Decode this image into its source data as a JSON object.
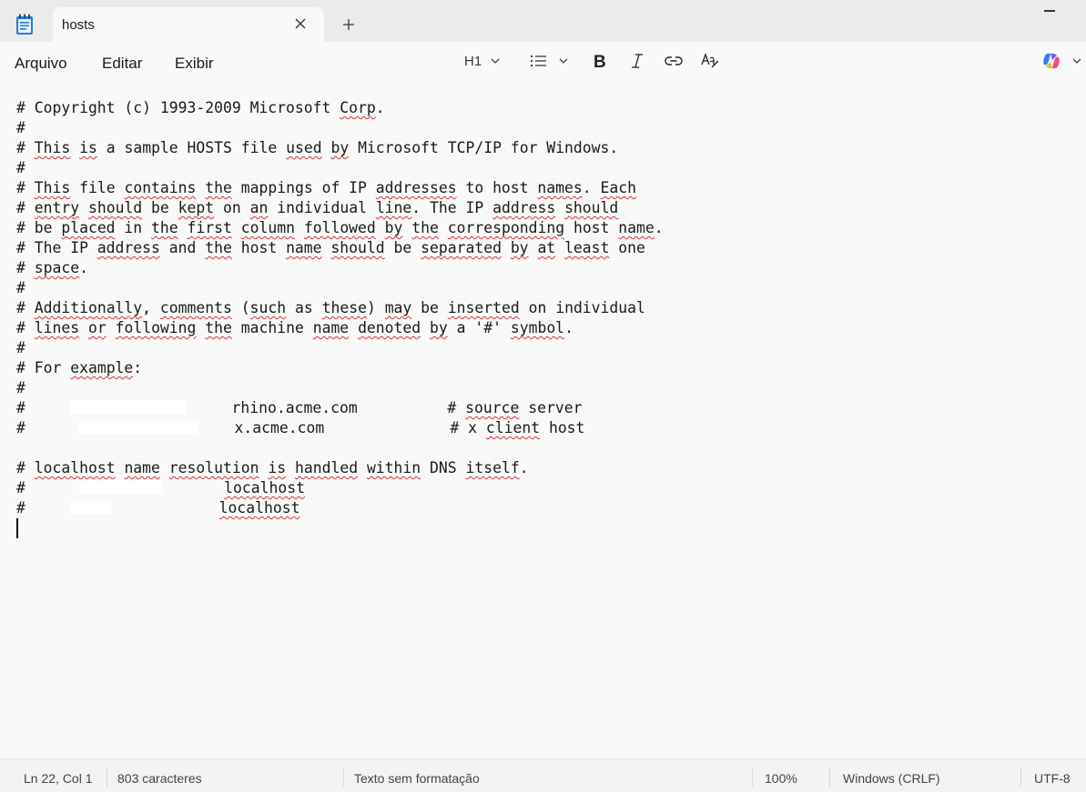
{
  "tab": {
    "title": "hosts"
  },
  "menu": {
    "file": "Arquivo",
    "edit": "Editar",
    "view": "Exibir"
  },
  "toolbar": {
    "heading": "H1",
    "icons": [
      "heading-icon",
      "list-icon",
      "bold-icon",
      "italic-icon",
      "link-icon",
      "clear-formatting-icon",
      "copilot-icon"
    ]
  },
  "lines": [
    [
      {
        "t": "# Copyright (c) 1993-2009 Microsoft "
      },
      {
        "t": "Corp",
        "e": 1
      },
      {
        "t": "."
      }
    ],
    [
      {
        "t": "#"
      }
    ],
    [
      {
        "t": "# "
      },
      {
        "t": "This",
        "e": 1
      },
      {
        "t": " "
      },
      {
        "t": "is",
        "e": 1
      },
      {
        "t": " a sample HOSTS file "
      },
      {
        "t": "used",
        "e": 1
      },
      {
        "t": " "
      },
      {
        "t": "by",
        "e": 1
      },
      {
        "t": " Microsoft TCP/IP for Windows."
      }
    ],
    [
      {
        "t": "#"
      }
    ],
    [
      {
        "t": "# "
      },
      {
        "t": "This",
        "e": 1
      },
      {
        "t": " file "
      },
      {
        "t": "contains",
        "e": 1
      },
      {
        "t": " "
      },
      {
        "t": "the",
        "e": 1
      },
      {
        "t": " mappings of IP "
      },
      {
        "t": "addresses",
        "e": 1
      },
      {
        "t": " to host "
      },
      {
        "t": "names",
        "e": 1
      },
      {
        "t": ". "
      },
      {
        "t": "Each",
        "e": 1
      }
    ],
    [
      {
        "t": "# "
      },
      {
        "t": "entry",
        "e": 1
      },
      {
        "t": " "
      },
      {
        "t": "should",
        "e": 1
      },
      {
        "t": " be "
      },
      {
        "t": "kept",
        "e": 1
      },
      {
        "t": " on "
      },
      {
        "t": "an",
        "e": 1
      },
      {
        "t": " individual "
      },
      {
        "t": "line",
        "e": 1
      },
      {
        "t": ". The IP "
      },
      {
        "t": "address",
        "e": 1
      },
      {
        "t": " "
      },
      {
        "t": "should",
        "e": 1
      }
    ],
    [
      {
        "t": "# be "
      },
      {
        "t": "placed",
        "e": 1
      },
      {
        "t": " in "
      },
      {
        "t": "the",
        "e": 1
      },
      {
        "t": " "
      },
      {
        "t": "first",
        "e": 1
      },
      {
        "t": " "
      },
      {
        "t": "column",
        "e": 1
      },
      {
        "t": " "
      },
      {
        "t": "followed",
        "e": 1
      },
      {
        "t": " "
      },
      {
        "t": "by",
        "e": 1
      },
      {
        "t": " "
      },
      {
        "t": "the",
        "e": 1
      },
      {
        "t": " "
      },
      {
        "t": "corresponding",
        "e": 1
      },
      {
        "t": " host "
      },
      {
        "t": "name",
        "e": 1
      },
      {
        "t": "."
      }
    ],
    [
      {
        "t": "# The IP "
      },
      {
        "t": "address",
        "e": 1
      },
      {
        "t": " and "
      },
      {
        "t": "the",
        "e": 1
      },
      {
        "t": " host "
      },
      {
        "t": "name",
        "e": 1
      },
      {
        "t": " "
      },
      {
        "t": "should",
        "e": 1
      },
      {
        "t": " be "
      },
      {
        "t": "separated",
        "e": 1
      },
      {
        "t": " "
      },
      {
        "t": "by",
        "e": 1
      },
      {
        "t": " "
      },
      {
        "t": "at",
        "e": 1
      },
      {
        "t": " "
      },
      {
        "t": "least",
        "e": 1
      },
      {
        "t": " one"
      }
    ],
    [
      {
        "t": "# "
      },
      {
        "t": "space",
        "e": 1
      },
      {
        "t": "."
      }
    ],
    [
      {
        "t": "#"
      }
    ],
    [
      {
        "t": "# "
      },
      {
        "t": "Additionally",
        "e": 1
      },
      {
        "t": ", "
      },
      {
        "t": "comments",
        "e": 1
      },
      {
        "t": " ("
      },
      {
        "t": "such",
        "e": 1
      },
      {
        "t": " as "
      },
      {
        "t": "these",
        "e": 1
      },
      {
        "t": ") "
      },
      {
        "t": "may",
        "e": 1
      },
      {
        "t": " be "
      },
      {
        "t": "inserted",
        "e": 1
      },
      {
        "t": " on individual"
      }
    ],
    [
      {
        "t": "# "
      },
      {
        "t": "lines",
        "e": 1
      },
      {
        "t": " "
      },
      {
        "t": "or",
        "e": 1
      },
      {
        "t": " "
      },
      {
        "t": "following",
        "e": 1
      },
      {
        "t": " "
      },
      {
        "t": "the",
        "e": 1
      },
      {
        "t": " machine "
      },
      {
        "t": "name",
        "e": 1
      },
      {
        "t": " "
      },
      {
        "t": "denoted",
        "e": 1
      },
      {
        "t": " "
      },
      {
        "t": "by",
        "e": 1
      },
      {
        "t": " a '#' "
      },
      {
        "t": "symbol",
        "e": 1
      },
      {
        "t": "."
      }
    ],
    [
      {
        "t": "#"
      }
    ],
    [
      {
        "t": "# For "
      },
      {
        "t": "example",
        "e": 1
      },
      {
        "t": ":"
      }
    ],
    [
      {
        "t": "#"
      }
    ],
    [
      {
        "t": "#     "
      },
      {
        "r": 1,
        "w": 128
      },
      {
        "t": "     rhino.acme.com          # "
      },
      {
        "t": "source",
        "e": 1
      },
      {
        "t": " server"
      }
    ],
    [
      {
        "t": "#      "
      },
      {
        "r": 1,
        "w": 131
      },
      {
        "t": "    x.acme.com              # x "
      },
      {
        "t": "client",
        "e": 1
      },
      {
        "t": " host"
      }
    ],
    [
      {
        "t": ""
      }
    ],
    [
      {
        "t": "# "
      },
      {
        "t": "localhost",
        "e": 1
      },
      {
        "t": " "
      },
      {
        "t": "name",
        "e": 1
      },
      {
        "t": " "
      },
      {
        "t": "resolution",
        "e": 1
      },
      {
        "t": " "
      },
      {
        "t": "is",
        "e": 1
      },
      {
        "t": " "
      },
      {
        "t": "handled",
        "e": 1
      },
      {
        "t": " "
      },
      {
        "t": "within",
        "e": 1
      },
      {
        "t": " DNS "
      },
      {
        "t": "itself",
        "e": 1
      },
      {
        "t": "."
      }
    ],
    [
      {
        "t": "#      "
      },
      {
        "r": 1,
        "w": 90
      },
      {
        "t": "       "
      },
      {
        "t": "localhost",
        "e": 1
      }
    ],
    [
      {
        "t": "#     "
      },
      {
        "r": 1,
        "w": 45
      },
      {
        "t": "            "
      },
      {
        "t": "localhost",
        "e": 1
      }
    ],
    [
      {
        "caret": 1
      }
    ]
  ],
  "status": {
    "position": "Ln 22, Col 1",
    "chars": "803 caracteres",
    "format": "Texto sem formatação",
    "zoom": "100%",
    "line_ending": "Windows (CRLF)",
    "encoding": "UTF-8"
  },
  "colors": {
    "spellcheck": "#d13438",
    "copilot_accent": "#7b5cff"
  }
}
